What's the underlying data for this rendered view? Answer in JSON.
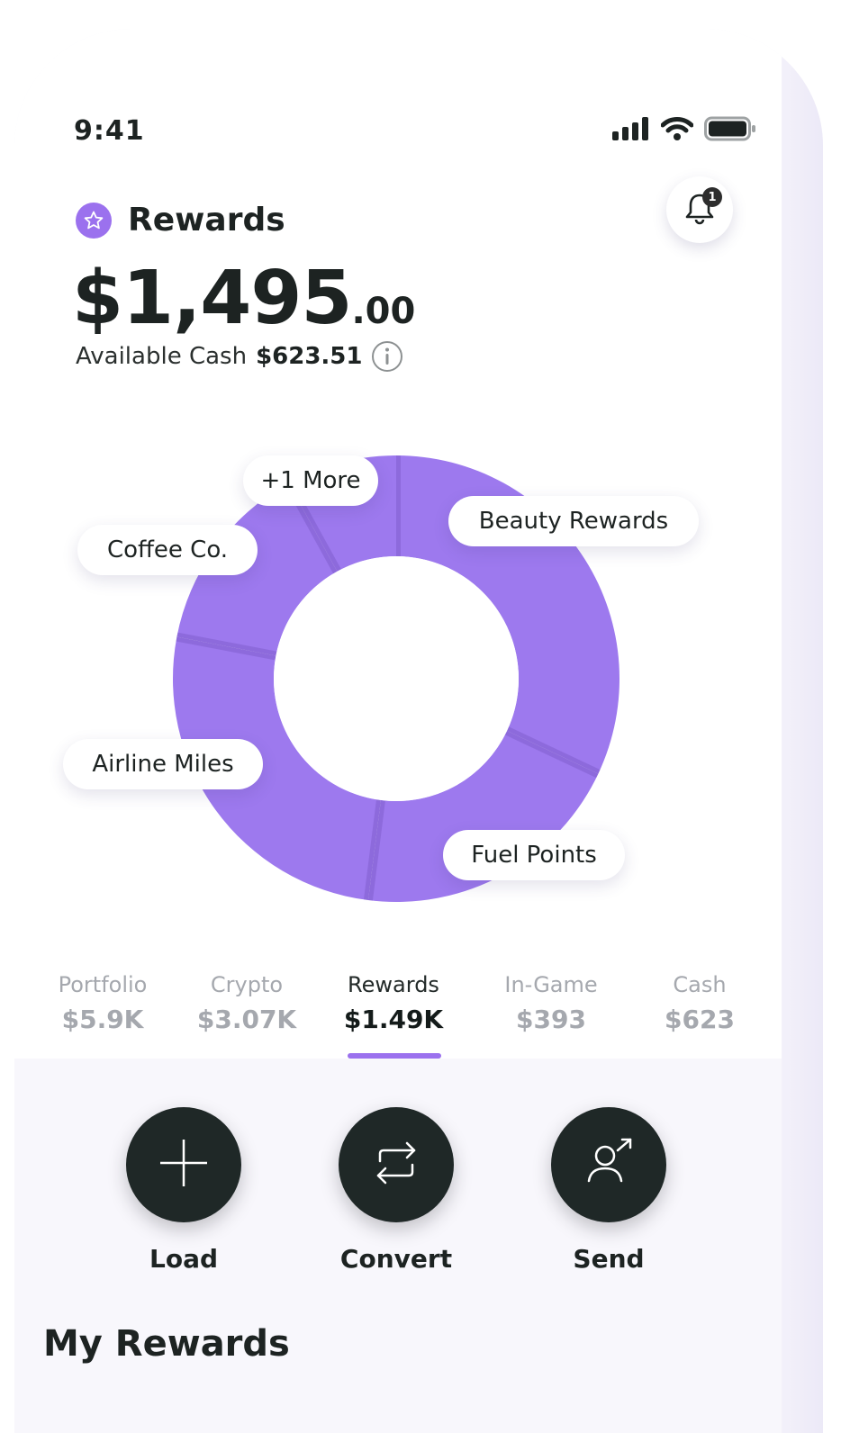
{
  "status_bar": {
    "time": "9:41"
  },
  "notifications": {
    "badge_count": "1"
  },
  "header": {
    "title": "Rewards",
    "balance_main": "$1,495",
    "balance_cents": ".00",
    "available_label": "Available Cash",
    "available_amount": "$623.51"
  },
  "chart_data": {
    "type": "pie",
    "style": "donut",
    "color": "#9d79ee",
    "segments": [
      {
        "label": "Beauty Rewards",
        "value": 32
      },
      {
        "label": "Fuel Points",
        "value": 20
      },
      {
        "label": "Airline Miles",
        "value": 26
      },
      {
        "label": "Coffee Co.",
        "value": 14
      },
      {
        "label": "+1 More",
        "value": 8
      }
    ]
  },
  "tabs": [
    {
      "label": "Portfolio",
      "value": "$5.9K",
      "active": false
    },
    {
      "label": "Crypto",
      "value": "$3.07K",
      "active": false
    },
    {
      "label": "Rewards",
      "value": "$1.49K",
      "active": true
    },
    {
      "label": "In-Game",
      "value": "$393",
      "active": false
    },
    {
      "label": "Cash",
      "value": "$623",
      "active": false
    }
  ],
  "actions": [
    {
      "label": "Load",
      "icon": "plus-icon"
    },
    {
      "label": "Convert",
      "icon": "convert-icon"
    },
    {
      "label": "Send",
      "icon": "send-user-icon"
    }
  ],
  "section": {
    "title": "My Rewards"
  },
  "colors": {
    "accent": "#9b71ee",
    "dark": "#1f2827",
    "muted": "#a5a8ae"
  }
}
